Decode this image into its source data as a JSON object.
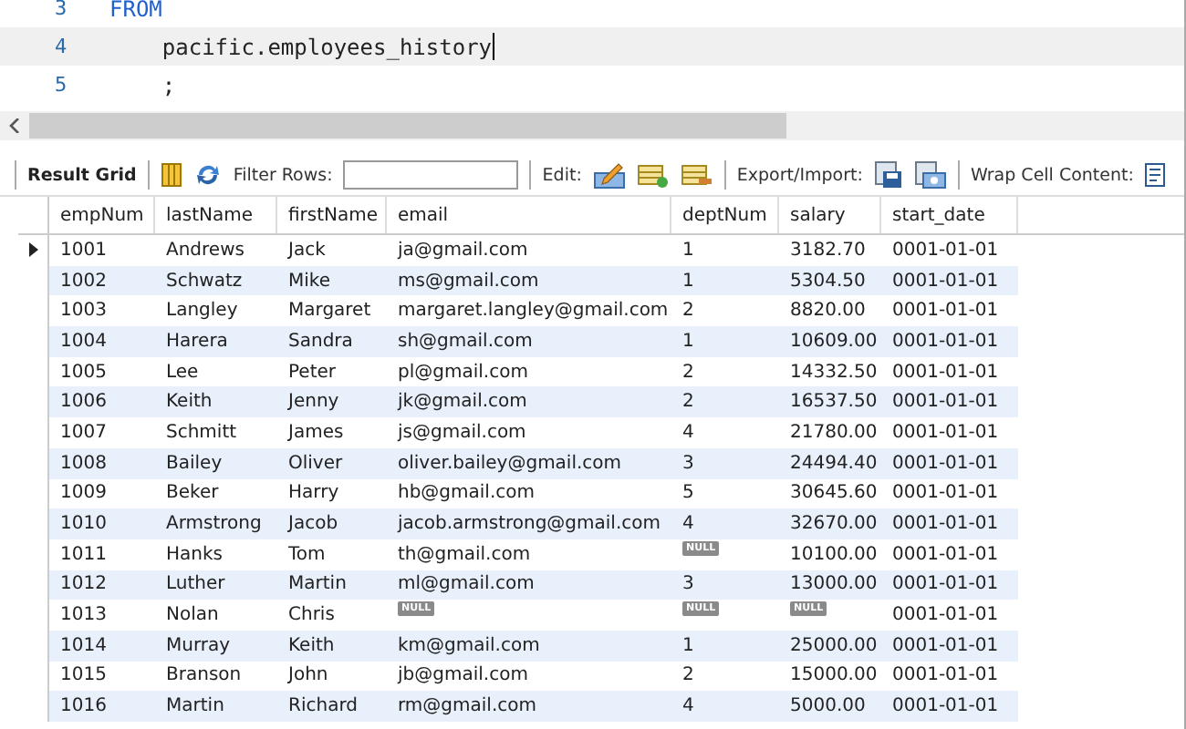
{
  "editor": {
    "lines": [
      {
        "number": "3",
        "code": "FROM",
        "keyword": true,
        "current": false
      },
      {
        "number": "4",
        "code": "    pacific.employees_history",
        "keyword": false,
        "current": true
      },
      {
        "number": "5",
        "code": "    ;",
        "keyword": false,
        "current": false
      }
    ]
  },
  "toolbar": {
    "result_tab": "Result Grid",
    "filter_label": "Filter Rows:",
    "edit_label": "Edit:",
    "export_label": "Export/Import:",
    "wrap_label": "Wrap Cell Content:"
  },
  "table": {
    "columns": [
      "empNum",
      "lastName",
      "firstName",
      "email",
      "deptNum",
      "salary",
      "start_date"
    ],
    "rows": [
      {
        "selected": true,
        "cells": [
          "1001",
          "Andrews",
          "Jack",
          "ja@gmail.com",
          "1",
          "3182.70",
          "0001-01-01"
        ]
      },
      {
        "selected": false,
        "cells": [
          "1002",
          "Schwatz",
          "Mike",
          "ms@gmail.com",
          "1",
          "5304.50",
          "0001-01-01"
        ]
      },
      {
        "selected": false,
        "cells": [
          "1003",
          "Langley",
          "Margaret",
          "margaret.langley@gmail.com",
          "2",
          "8820.00",
          "0001-01-01"
        ]
      },
      {
        "selected": false,
        "cells": [
          "1004",
          "Harera",
          "Sandra",
          "sh@gmail.com",
          "1",
          "10609.00",
          "0001-01-01"
        ]
      },
      {
        "selected": false,
        "cells": [
          "1005",
          "Lee",
          "Peter",
          "pl@gmail.com",
          "2",
          "14332.50",
          "0001-01-01"
        ]
      },
      {
        "selected": false,
        "cells": [
          "1006",
          "Keith",
          "Jenny",
          "jk@gmail.com",
          "2",
          "16537.50",
          "0001-01-01"
        ]
      },
      {
        "selected": false,
        "cells": [
          "1007",
          "Schmitt",
          "James",
          "js@gmail.com",
          "4",
          "21780.00",
          "0001-01-01"
        ]
      },
      {
        "selected": false,
        "cells": [
          "1008",
          "Bailey",
          "Oliver",
          "oliver.bailey@gmail.com",
          "3",
          "24494.40",
          "0001-01-01"
        ]
      },
      {
        "selected": false,
        "cells": [
          "1009",
          "Beker",
          "Harry",
          "hb@gmail.com",
          "5",
          "30645.60",
          "0001-01-01"
        ]
      },
      {
        "selected": false,
        "cells": [
          "1010",
          "Armstrong",
          "Jacob",
          "jacob.armstrong@gmail.com",
          "4",
          "32670.00",
          "0001-01-01"
        ]
      },
      {
        "selected": false,
        "cells": [
          "1011",
          "Hanks",
          "Tom",
          "th@gmail.com",
          {
            "kind": "null",
            "text": "NULL"
          },
          "10100.00",
          "0001-01-01"
        ]
      },
      {
        "selected": false,
        "cells": [
          "1012",
          "Luther",
          "Martin",
          "ml@gmail.com",
          "3",
          "13000.00",
          "0001-01-01"
        ]
      },
      {
        "selected": false,
        "cells": [
          "1013",
          "Nolan",
          "Chris",
          {
            "kind": "null",
            "text": "NULL"
          },
          {
            "kind": "null",
            "text": "NULL"
          },
          {
            "kind": "null",
            "text": "NULL"
          },
          "0001-01-01"
        ]
      },
      {
        "selected": false,
        "cells": [
          "1014",
          "Murray",
          "Keith",
          "km@gmail.com",
          "1",
          "25000.00",
          "0001-01-01"
        ]
      },
      {
        "selected": false,
        "cells": [
          "1015",
          "Branson",
          "John",
          "jb@gmail.com",
          "2",
          "15000.00",
          "0001-01-01"
        ]
      },
      {
        "selected": false,
        "cells": [
          "1016",
          "Martin",
          "Richard",
          "rm@gmail.com",
          "4",
          "5000.00",
          "0001-01-01"
        ]
      }
    ]
  }
}
